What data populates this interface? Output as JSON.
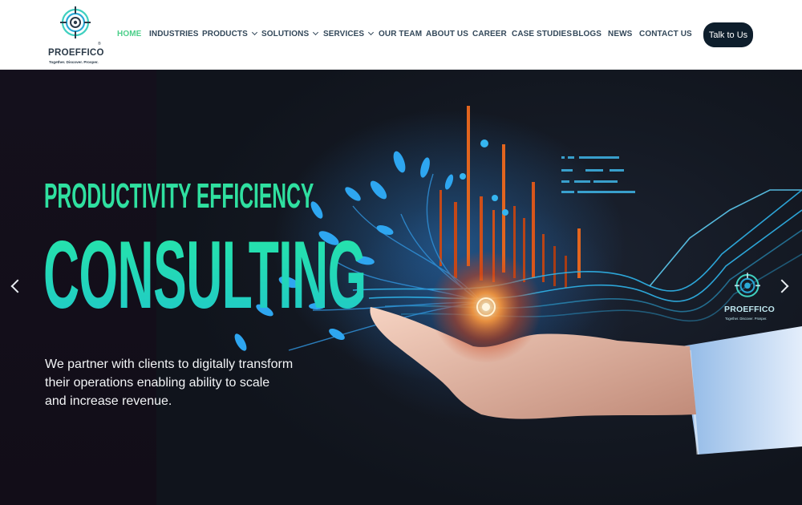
{
  "brand": {
    "name": "PROEFFICO",
    "reg_mark": "®",
    "tagline": "Together. Discover. Prosper.",
    "accent_color": "#4ccf8a",
    "dark_color": "#0e1e2c"
  },
  "nav": {
    "items": [
      {
        "label": "HOME",
        "active": true,
        "dropdown": false
      },
      {
        "label": "INDUSTRIES",
        "active": false,
        "dropdown": false
      },
      {
        "label": "PRODUCTS",
        "active": false,
        "dropdown": true
      },
      {
        "label": "SOLUTIONS",
        "active": false,
        "dropdown": true
      },
      {
        "label": "SERVICES",
        "active": false,
        "dropdown": true
      },
      {
        "label": "OUR TEAM",
        "active": false,
        "dropdown": false
      },
      {
        "label": "ABOUT US",
        "active": false,
        "dropdown": false
      },
      {
        "label": "CAREER",
        "active": false,
        "dropdown": false
      },
      {
        "label": "CASE STUDIES",
        "active": false,
        "dropdown": false
      },
      {
        "label": "BLOGS",
        "active": false,
        "dropdown": false
      },
      {
        "label": "NEWS",
        "active": false,
        "dropdown": false
      },
      {
        "label": "CONTACT US",
        "active": false,
        "dropdown": false
      }
    ],
    "cta_label": "Talk to Us"
  },
  "hero": {
    "headline_small": "PRODUCTIVITY  EFFICIENCY",
    "headline_large": "CONSULTING",
    "description": "We partner with clients to digitally transform their operations enabling ability to scale and increase revenue.",
    "prev_icon": "chevron-left-icon",
    "next_icon": "chevron-right-icon"
  }
}
